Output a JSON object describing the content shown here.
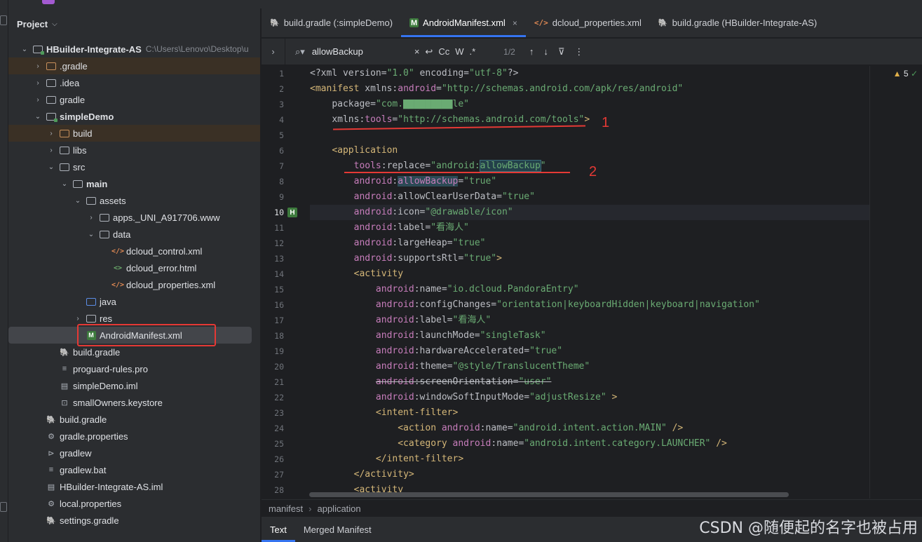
{
  "project": {
    "title": "Project",
    "tree": [
      {
        "label": "HBuilder-Integrate-AS",
        "hint": "C:\\Users\\Lenovo\\Desktop\\u",
        "indent": 0,
        "arrow": "open",
        "icon": "module-folder",
        "bold": true
      },
      {
        "label": ".gradle",
        "indent": 1,
        "arrow": "closed",
        "icon": "folder-orange",
        "excluded": true
      },
      {
        "label": ".idea",
        "indent": 1,
        "arrow": "closed",
        "icon": "folder"
      },
      {
        "label": "gradle",
        "indent": 1,
        "arrow": "closed",
        "icon": "folder"
      },
      {
        "label": "simpleDemo",
        "indent": 1,
        "arrow": "open",
        "icon": "module-folder",
        "bold": true
      },
      {
        "label": "build",
        "indent": 2,
        "arrow": "closed",
        "icon": "folder-orange",
        "excluded": true
      },
      {
        "label": "libs",
        "indent": 2,
        "arrow": "closed",
        "icon": "folder"
      },
      {
        "label": "src",
        "indent": 2,
        "arrow": "open",
        "icon": "folder"
      },
      {
        "label": "main",
        "indent": 3,
        "arrow": "open",
        "icon": "folder",
        "bold": true
      },
      {
        "label": "assets",
        "indent": 4,
        "arrow": "open",
        "icon": "folder"
      },
      {
        "label": "apps._UNI_A917706.www",
        "indent": 5,
        "arrow": "closed",
        "icon": "folder"
      },
      {
        "label": "data",
        "indent": 5,
        "arrow": "open",
        "icon": "folder"
      },
      {
        "label": "dcloud_control.xml",
        "indent": 6,
        "arrow": "none",
        "icon": "xml"
      },
      {
        "label": "dcloud_error.html",
        "indent": 6,
        "arrow": "none",
        "icon": "html"
      },
      {
        "label": "dcloud_properties.xml",
        "indent": 6,
        "arrow": "none",
        "icon": "xml"
      },
      {
        "label": "java",
        "indent": 4,
        "arrow": "none",
        "icon": "folder-blue"
      },
      {
        "label": "res",
        "indent": 4,
        "arrow": "closed",
        "icon": "folder"
      },
      {
        "label": "AndroidManifest.xml",
        "indent": 4,
        "arrow": "none",
        "icon": "manifest",
        "selected": true
      },
      {
        "label": "build.gradle",
        "indent": 2,
        "arrow": "none",
        "icon": "gradle"
      },
      {
        "label": "proguard-rules.pro",
        "indent": 2,
        "arrow": "none",
        "icon": "text"
      },
      {
        "label": "simpleDemo.iml",
        "indent": 2,
        "arrow": "none",
        "icon": "iml"
      },
      {
        "label": "smallOwners.keystore",
        "indent": 2,
        "arrow": "none",
        "icon": "keystore"
      },
      {
        "label": "build.gradle",
        "indent": 1,
        "arrow": "none",
        "icon": "gradle"
      },
      {
        "label": "gradle.properties",
        "indent": 1,
        "arrow": "none",
        "icon": "settings"
      },
      {
        "label": "gradlew",
        "indent": 1,
        "arrow": "none",
        "icon": "terminal"
      },
      {
        "label": "gradlew.bat",
        "indent": 1,
        "arrow": "none",
        "icon": "text"
      },
      {
        "label": "HBuilder-Integrate-AS.iml",
        "indent": 1,
        "arrow": "none",
        "icon": "iml"
      },
      {
        "label": "local.properties",
        "indent": 1,
        "arrow": "none",
        "icon": "settings"
      },
      {
        "label": "settings.gradle",
        "indent": 1,
        "arrow": "none",
        "icon": "gradle"
      }
    ]
  },
  "tabs": [
    {
      "label": "build.gradle (:simpleDemo)",
      "icon": "gradle-icon"
    },
    {
      "label": "AndroidManifest.xml",
      "icon": "manifest-icon",
      "active": true,
      "close": "×"
    },
    {
      "label": "dcloud_properties.xml",
      "icon": "xml-icon"
    },
    {
      "label": "build.gradle (HBuilder-Integrate-AS)",
      "icon": "gradle-icon"
    }
  ],
  "search": {
    "value": "allowBackup",
    "count": "1/2",
    "clear": "×",
    "case": "Cc",
    "word": "W",
    "regex": ".*"
  },
  "editor": {
    "warnings": "5",
    "current_line": 10,
    "lines": [
      {
        "n": 1,
        "html": "<span class='pi'>&lt;?xml version=</span><span class='str'>\"1.0\"</span><span class='pi'> encoding=</span><span class='str'>\"utf-8\"</span><span class='pi'>?&gt;</span>"
      },
      {
        "n": 2,
        "html": "<span class='tag'>&lt;manifest </span><span class='attr'>xmlns:</span><span class='ns'>android</span><span class='attr'>=</span><span class='str'>\"http://schemas.android.com/apk/res/android\"</span>"
      },
      {
        "n": 3,
        "html": "    <span class='attr'>package=</span><span class='str'>\"com.▇▇▇▇▇▇▇▇▇le\"</span>"
      },
      {
        "n": 4,
        "html": "    <span class='attr'>xmlns:</span><span class='ns'>tools</span><span class='attr'>=</span><span class='str'>\"http://schemas.android.com/tools\"</span><span class='tag'>&gt;</span>"
      },
      {
        "n": 5,
        "html": ""
      },
      {
        "n": 6,
        "html": "    <span class='tag'>&lt;application</span>"
      },
      {
        "n": 7,
        "html": "        <span class='ns'>tools</span><span class='attr'>:replace=</span><span class='str'>\"android:<span class='hl'>allowBackup</span>\"</span>"
      },
      {
        "n": 8,
        "html": "        <span class='ns'>android</span><span class='attr'>:</span><span class='hl2'>allowBackup</span><span class='attr'>=</span><span class='str'>\"true\"</span>"
      },
      {
        "n": 9,
        "html": "        <span class='ns'>android</span><span class='attr'>:allowClearUserData=</span><span class='str'>\"true\"</span>"
      },
      {
        "n": 10,
        "html": "        <span class='ns'>android</span><span class='attr'>:icon=</span><span class='str'>\"@drawable/icon\"</span>"
      },
      {
        "n": 11,
        "html": "        <span class='ns'>android</span><span class='attr'>:label=</span><span class='str'>\"看海人\"</span>"
      },
      {
        "n": 12,
        "html": "        <span class='ns'>android</span><span class='attr'>:largeHeap=</span><span class='str'>\"true\"</span>"
      },
      {
        "n": 13,
        "html": "        <span class='ns'>android</span><span class='attr'>:supportsRtl=</span><span class='str'>\"true\"</span><span class='tag'>&gt;</span>"
      },
      {
        "n": 14,
        "html": "        <span class='tag'>&lt;activity</span>"
      },
      {
        "n": 15,
        "html": "            <span class='ns'>android</span><span class='attr'>:name=</span><span class='str'>\"io.dcloud.PandoraEntry\"</span>"
      },
      {
        "n": 16,
        "html": "            <span class='ns'>android</span><span class='attr'>:configChanges=</span><span class='str'>\"orientation|keyboardHidden|keyboard|navigation\"</span>"
      },
      {
        "n": 17,
        "html": "            <span class='ns'>android</span><span class='attr'>:label=</span><span class='str'>\"看海人\"</span>"
      },
      {
        "n": 18,
        "html": "            <span class='ns'>android</span><span class='attr'>:launchMode=</span><span class='str'>\"singleTask\"</span>"
      },
      {
        "n": 19,
        "html": "            <span class='ns'>android</span><span class='attr'>:hardwareAccelerated=</span><span class='str'>\"true\"</span>"
      },
      {
        "n": 20,
        "html": "            <span class='ns'>android</span><span class='attr'>:theme=</span><span class='str'>\"@style/TranslucentTheme\"</span>"
      },
      {
        "n": 21,
        "html": "            <span class='strike'><span class='ns'>android</span><span class='attr'>:screenOrientation=</span><span class='str'>\"user\"</span></span>"
      },
      {
        "n": 22,
        "html": "            <span class='ns'>android</span><span class='attr'>:windowSoftInputMode=</span><span class='str'>\"adjustResize\"</span><span class='tag'> &gt;</span>"
      },
      {
        "n": 23,
        "html": "            <span class='tag'>&lt;intent-filter&gt;</span>"
      },
      {
        "n": 24,
        "html": "                <span class='tag'>&lt;action </span><span class='ns'>android</span><span class='attr'>:name=</span><span class='str'>\"android.intent.action.MAIN\"</span><span class='tag'> /&gt;</span>"
      },
      {
        "n": 25,
        "html": "                <span class='tag'>&lt;category </span><span class='ns'>android</span><span class='attr'>:name=</span><span class='str'>\"android.intent.category.LAUNCHER\"</span><span class='tag'> /&gt;</span>"
      },
      {
        "n": 26,
        "html": "            <span class='tag'>&lt;/intent-filter&gt;</span>"
      },
      {
        "n": 27,
        "html": "        <span class='tag'>&lt;/activity&gt;</span>"
      },
      {
        "n": 28,
        "html": "        <span class='tag'>&lt;activity</span>"
      }
    ],
    "annotations": [
      {
        "text": "1"
      },
      {
        "text": "2"
      }
    ]
  },
  "breadcrumb": [
    "manifest",
    "application"
  ],
  "bottom_tabs": [
    {
      "label": "Text",
      "active": true
    },
    {
      "label": "Merged Manifest"
    }
  ],
  "watermark": "CSDN @随便起的名字也被占用",
  "colors": {
    "accent": "#3574f0",
    "annotation": "#e53935"
  }
}
